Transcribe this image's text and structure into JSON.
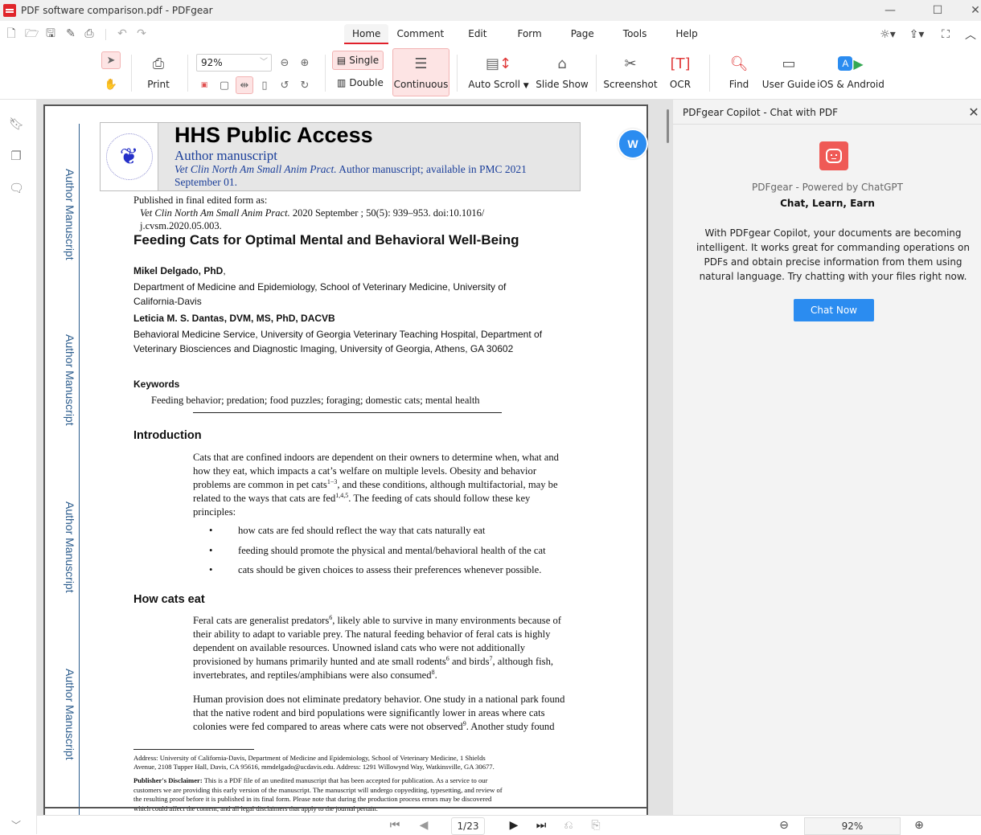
{
  "window": {
    "title": "PDF software comparison.pdf - PDFgear",
    "controls": [
      "minimize",
      "maximize",
      "close"
    ]
  },
  "quick_access": {
    "icons": [
      "new-file-icon",
      "open-folder-icon",
      "save-icon",
      "save-as-icon",
      "print-icon",
      "undo-icon",
      "redo-icon"
    ]
  },
  "menu": {
    "tabs": [
      "Home",
      "Comment",
      "Edit",
      "Form",
      "Page",
      "Tools",
      "Help"
    ],
    "active": "Home"
  },
  "ribbon": {
    "print": "Print",
    "zoom_value": "92%",
    "single": "Single",
    "double": "Double",
    "continuous": "Continuous",
    "auto_scroll": "Auto Scroll",
    "slide_show": "Slide Show",
    "screenshot": "Screenshot",
    "ocr": "OCR",
    "find": "Find",
    "user_guide": "User Guide",
    "ios_android": "iOS & Android"
  },
  "document": {
    "side_label": "Author Manuscript",
    "hhs_title": "HHS Public Access",
    "hhs_subtitle": "Author manuscript",
    "hhs_journal": "Vet Clin North Am Small Anim Pract.",
    "hhs_citation_rest": " Author manuscript; available in PMC 2021 September 01.",
    "published_label": "Published in final edited form as:",
    "published_journal": "Vet Clin North Am Small Anim Pract.",
    "published_rest": " 2020 September ; 50(5): 939–953. doi:10.1016/",
    "published_doi_line2": "j.cvsm.2020.05.003.",
    "article_title": "Feeding Cats for Optimal Mental and Behavioral Well-Being",
    "author1_name": "Mikel Delgado, PhD",
    "author1_affil_1": "Department of Medicine and Epidemiology, School of Veterinary Medicine, University of",
    "author1_affil_2": "California-Davis",
    "author2_name": "Leticia M. S. Dantas, DVM, MS, PhD, DACVB",
    "author2_affil_1": "Behavioral Medicine Service, University of Georgia Veterinary Teaching Hospital, Department of",
    "author2_affil_2": "Veterinary Biosciences and Diagnostic Imaging, University of Georgia, Athens, GA 30602",
    "keywords_heading": "Keywords",
    "keywords": "Feeding behavior; predation; food puzzles; foraging; domestic cats; mental health",
    "intro_heading": "Introduction",
    "intro_lines": [
      "Cats that are confined indoors are dependent on their owners to determine when, what and",
      "how they eat, which impacts a cat’s welfare on multiple levels. Obesity and behavior",
      "problems are common in pet cats",
      "related to the ways that cats are fed",
      "principles:"
    ],
    "intro_sup_1": "1−3",
    "intro_line3_rest": ", and these conditions, although multifactorial, may be",
    "intro_sup_2": "1,4,5",
    "intro_line4_rest": ". The feeding of cats should follow these key",
    "bullets": [
      "how cats are fed should reflect the way that cats naturally eat",
      "feeding should promote the physical and mental/behavioral health of the cat",
      "cats should be given choices to assess their preferences whenever possible."
    ],
    "bullet_char": "•",
    "how_heading": "How cats eat",
    "how_p1": {
      "l1a": "Feral cats are generalist predators",
      "l1sup": "6",
      "l1b": ", likely able to survive in many environments because of",
      "l2": "their ability to adapt to variable prey. The natural feeding behavior of feral cats is highly",
      "l3": "dependent on available resources. Unowned island cats who were not additionally",
      "l4a": "provisioned by humans primarily hunted and ate small rodents",
      "l4sup1": "6",
      "l4b": " and birds",
      "l4sup2": "7",
      "l4c": ", although fish,",
      "l5a": "invertebrates, and reptiles/amphibians were also consumed",
      "l5sup": "8",
      "l5b": "."
    },
    "how_p2": {
      "l1": "Human provision does not eliminate predatory behavior. One study in a national park found",
      "l2": "that the native rodent and bird populations were significantly lower in areas where cats",
      "l3a": "colonies were fed compared to areas where cats were not observed",
      "l3sup": "9",
      "l3b": ". Another study found"
    },
    "footnote_address_1": "Address: University of California-Davis, Department of Medicine and Epidemiology, School of Veterinary Medicine, 1 Shields",
    "footnote_address_2": "Avenue, 2108 Tupper Hall, Davis, CA 95616, mmdelgado@ucdavis.edu. Address: 1291 Willowynd Way, Watkinsville, GA 30677.",
    "disclaimer_label": "Publisher's Disclaimer:",
    "disclaimer_1": " This is a PDF file of an unedited manuscript that has been accepted for publication. As a service to our",
    "disclaimer_2": "customers we are providing this early version of the manuscript. The manuscript will undergo copyediting, typesetting, and review of",
    "disclaimer_3": "the resulting proof before it is published in its final form. Please note that during the production process errors may be discovered",
    "disclaimer_4": "which could affect the content, and all legal disclaimers that apply to the journal pertain."
  },
  "convert_button": {
    "label": "W"
  },
  "copilot": {
    "title": "PDFgear Copilot - Chat with PDF",
    "powered_by": "PDFgear - Powered by ChatGPT",
    "tagline": "Chat, Learn, Earn",
    "description": "With PDFgear Copilot, your documents are becoming intelligent. It works great for commanding operations on PDFs and obtain precise information from them using natural language. Try chatting with your files right now.",
    "chat_button": "Chat Now",
    "accent": "#2b8cf0",
    "icon_color": "#ef5a56"
  },
  "status_bar": {
    "page_indicator": "1/23",
    "zoom": "92%"
  },
  "colors": {
    "brand_red": "#e0202a",
    "highlight_bg": "#fde4e4",
    "author_manuscript_blue": "#2a5b8c"
  }
}
